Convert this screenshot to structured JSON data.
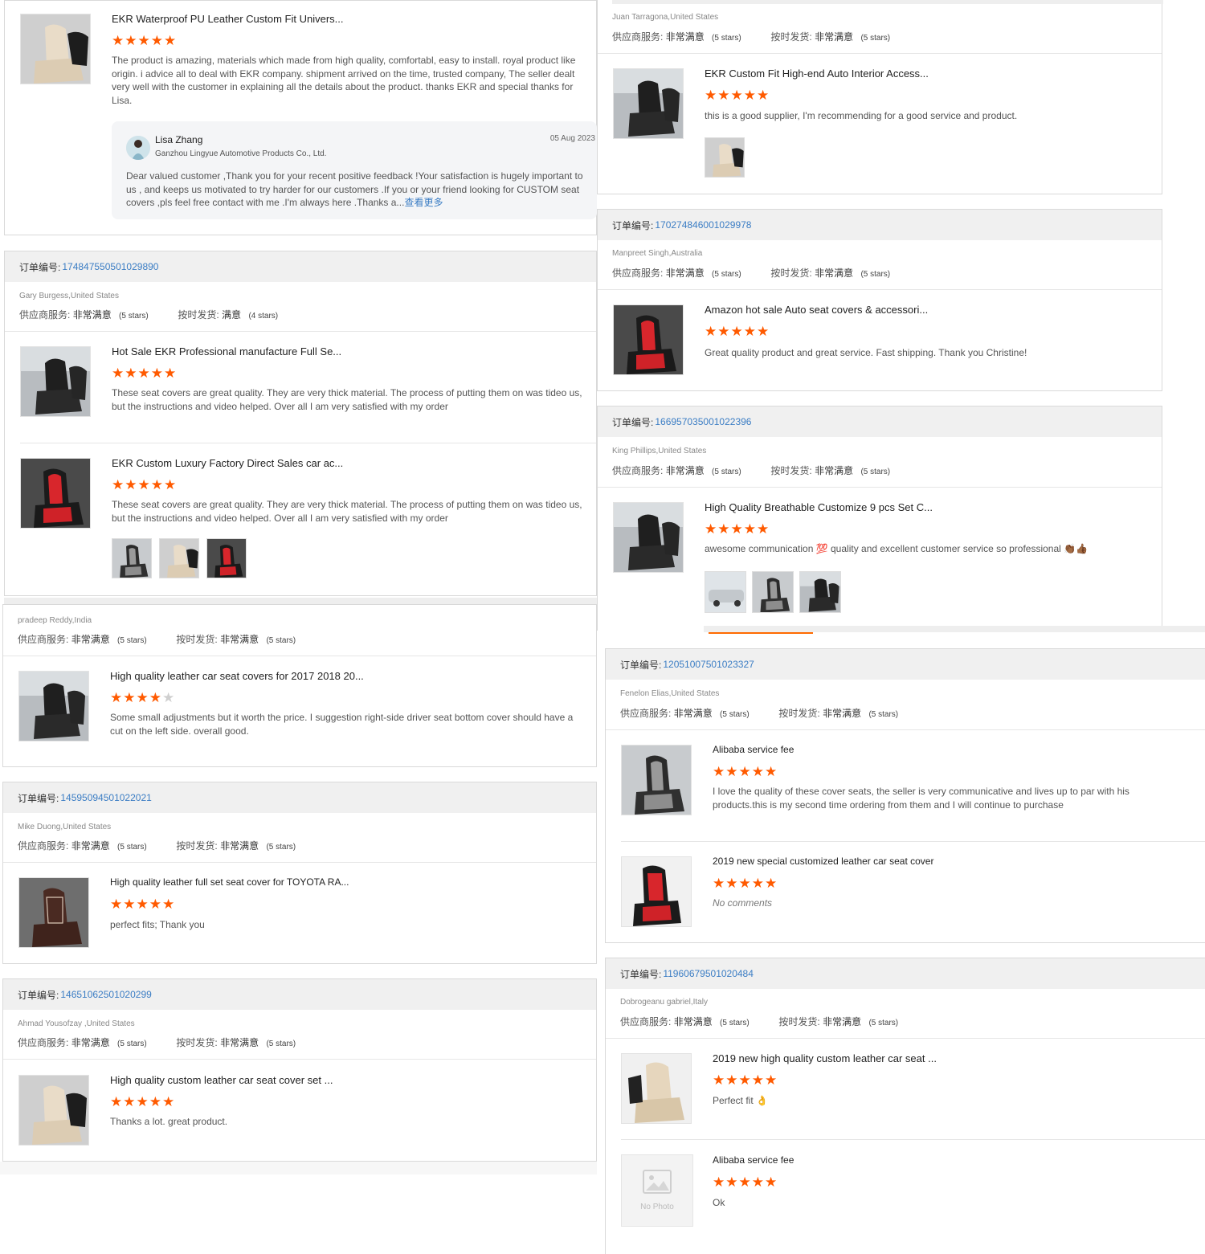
{
  "labels": {
    "order_no": "订单编号:",
    "supplier_service": "供应商服务:",
    "on_time": "按时发货:",
    "very_satisfied": "非常满意",
    "satisfied": "满意",
    "five_stars": "(5 stars)",
    "four_stars": "(4 stars)",
    "no_photo": "No Photo",
    "see_more": "查看更多"
  },
  "colors": {
    "star": "#ff5a00",
    "link": "#3b7dc4",
    "order_bar": "#f0f0f0"
  },
  "left": {
    "review1": {
      "product_title": "EKR Waterproof PU Leather Custom Fit Univers...",
      "rating": 5,
      "comment": "The product is amazing, materials which made from high quality, comfortabl, easy to install. royal product like origin. i advice all to deal with EKR company. shipment arrived on the time, trusted company, The seller dealt very well with the customer in explaining all the details about the product. thanks EKR and special thanks for Lisa.",
      "reply": {
        "name": "Lisa Zhang",
        "company": "Ganzhou Lingyue Automotive Products Co., Ltd.",
        "date": "05 Aug 2023",
        "text": "Dear valued customer ,Thank you for your recent positive feedback !Your satisfaction is hugely important to us , and keeps us motivated to try harder for our customers .If you or your friend looking for CUSTOM seat covers ,pls feel free contact with me .I'm always here .Thanks a..."
      }
    },
    "order2": {
      "order_number": "174847550501029890",
      "buyer": "Gary Burgess,United States",
      "supplier_rating": "非常满意",
      "supplier_stars": "(5 stars)",
      "shipping_rating": "满意",
      "shipping_stars": "(4 stars)",
      "products": [
        {
          "title": "Hot Sale EKR Professional manufacture Full Se...",
          "rating": 5,
          "comment": "These seat covers are great quality. They are very thick material. The process of putting them on was tideo us, but the instructions and video helped. Over all I am very satisfied with my order"
        },
        {
          "title": "EKR Custom Luxury Factory Direct Sales car ac...",
          "rating": 5,
          "comment": "These seat covers are great quality. They are very thick material. The process of putting them on was tideo us, but the instructions and video helped. Over all I am very satisfied with my order"
        }
      ]
    },
    "order3": {
      "buyer": "pradeep Reddy,India",
      "supplier_rating": "非常满意",
      "supplier_stars": "(5 stars)",
      "shipping_rating": "非常满意",
      "shipping_stars": "(5 stars)",
      "products": [
        {
          "title": "High quality leather car seat covers for 2017 2018 20...",
          "rating": 4,
          "comment": "Some small adjustments but it worth the price. I suggestion right-side driver seat bottom cover should have a cut on the left side. overall good."
        }
      ]
    },
    "order4": {
      "order_number": "14595094501022021",
      "buyer": "Mike Duong,United States",
      "supplier_rating": "非常满意",
      "supplier_stars": "(5 stars)",
      "shipping_rating": "非常满意",
      "shipping_stars": "(5 stars)",
      "products": [
        {
          "title": "High quality leather full set seat cover for TOYOTA RA...",
          "rating": 5,
          "comment": "perfect fits; Thank you"
        }
      ]
    },
    "order5": {
      "order_number": "14651062501020299",
      "buyer": "Ahmad Yousofzay ,United States",
      "supplier_rating": "非常满意",
      "supplier_stars": "(5 stars)",
      "shipping_rating": "非常满意",
      "shipping_stars": "(5 stars)",
      "products": [
        {
          "title": "High quality custom leather car seat cover set ...",
          "rating": 5,
          "comment": "Thanks a lot. great product."
        }
      ]
    }
  },
  "right": {
    "order1": {
      "buyer": "Juan Tarragona,United States",
      "supplier_rating": "非常满意",
      "supplier_stars": "(5 stars)",
      "shipping_rating": "非常满意",
      "shipping_stars": "(5 stars)",
      "products": [
        {
          "title": "EKR Custom Fit High-end Auto Interior Access...",
          "rating": 5,
          "comment": "this is a good  supplier, I'm recommending  for a good service and product."
        }
      ]
    },
    "order2": {
      "order_number": "170274846001029978",
      "buyer": "Manpreet Singh,Australia",
      "supplier_rating": "非常满意",
      "supplier_stars": "(5 stars)",
      "shipping_rating": "非常满意",
      "shipping_stars": "(5 stars)",
      "products": [
        {
          "title": "Amazon hot sale Auto seat covers & accessori...",
          "rating": 5,
          "comment": "Great quality product and great service. Fast shipping. Thank you Christine!"
        }
      ]
    },
    "order3": {
      "order_number": "166957035001022396",
      "buyer": "King Phillips,United States",
      "supplier_rating": "非常满意",
      "supplier_stars": "(5 stars)",
      "shipping_rating": "非常满意",
      "shipping_stars": "(5 stars)",
      "products": [
        {
          "title": "High Quality Breathable Customize 9 pcs Set C...",
          "rating": 5,
          "comment": "awesome communication 💯 quality and excellent customer service so professional 👏🏾👍🏾"
        }
      ]
    },
    "order4": {
      "order_number": "12051007501023327",
      "buyer": "Fenelon Elias,United States",
      "supplier_rating": "非常满意",
      "supplier_stars": "(5 stars)",
      "shipping_rating": "非常满意",
      "shipping_stars": "(5 stars)",
      "products": [
        {
          "title": "Alibaba service fee",
          "rating": 5,
          "comment": "I love the quality of these cover seats, the seller is very communicative and lives up to par with his products.this is my second time ordering from them and I will continue to purchase"
        },
        {
          "title": "2019 new special customized leather car seat cover",
          "rating": 5,
          "comment": "No comments"
        }
      ]
    },
    "order5": {
      "order_number": "11960679501020484",
      "buyer": "Dobrogeanu gabriel,Italy",
      "supplier_rating": "非常满意",
      "supplier_stars": "(5 stars)",
      "shipping_rating": "非常满意",
      "shipping_stars": "(5 stars)",
      "products": [
        {
          "title": "2019 new high quality custom leather car seat ...",
          "rating": 5,
          "comment": "Perfect fit 👌"
        },
        {
          "title": "Alibaba service fee",
          "rating": 5,
          "comment": "Ok"
        }
      ]
    }
  }
}
